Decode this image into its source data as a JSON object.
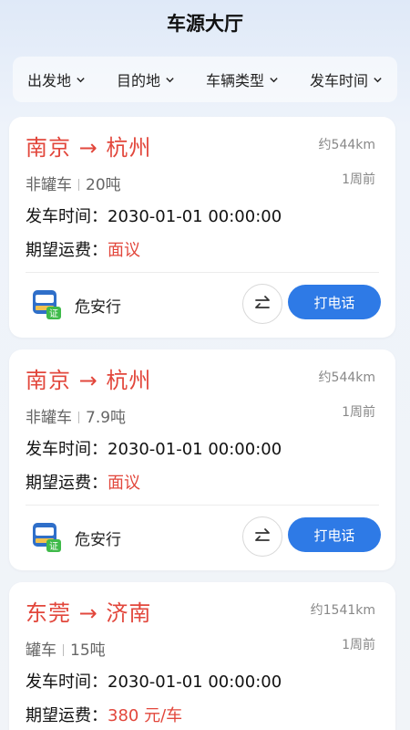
{
  "header": {
    "title": "车源大厅"
  },
  "filters": [
    {
      "label": "出发地"
    },
    {
      "label": "目的地"
    },
    {
      "label": "车辆类型"
    },
    {
      "label": "发车时间"
    }
  ],
  "listings": [
    {
      "origin": "南京",
      "destination": "杭州",
      "arrow": "→",
      "distance": "约544km",
      "vehicle_type": "非罐车",
      "tonnage": "20吨",
      "posted": "1周前",
      "depart_label": "发车时间：",
      "depart_time": "2030-01-01 00:00:00",
      "fee_label": "期望运费：",
      "fee_value": "面议",
      "company": "危安行",
      "call_label": "打电话"
    },
    {
      "origin": "南京",
      "destination": "杭州",
      "arrow": "→",
      "distance": "约544km",
      "vehicle_type": "非罐车",
      "tonnage": "7.9吨",
      "posted": "1周前",
      "depart_label": "发车时间：",
      "depart_time": "2030-01-01 00:00:00",
      "fee_label": "期望运费：",
      "fee_value": "面议",
      "company": "危安行",
      "call_label": "打电话"
    },
    {
      "origin": "东莞",
      "destination": "济南",
      "arrow": "→",
      "distance": "约1541km",
      "vehicle_type": "罐车",
      "tonnage": "15吨",
      "posted": "1周前",
      "depart_label": "发车时间：",
      "depart_time": "2030-01-01 00:00:00",
      "fee_label": "期望运费：",
      "fee_value": "380 元/车"
    }
  ],
  "logo_badge": "证",
  "colors": {
    "accent_red": "#e2473c",
    "accent_blue": "#2e7ae6",
    "badge_green": "#3fba4a"
  },
  "icons": [
    "chevron-down-icon",
    "swap-icon",
    "company-logo"
  ]
}
